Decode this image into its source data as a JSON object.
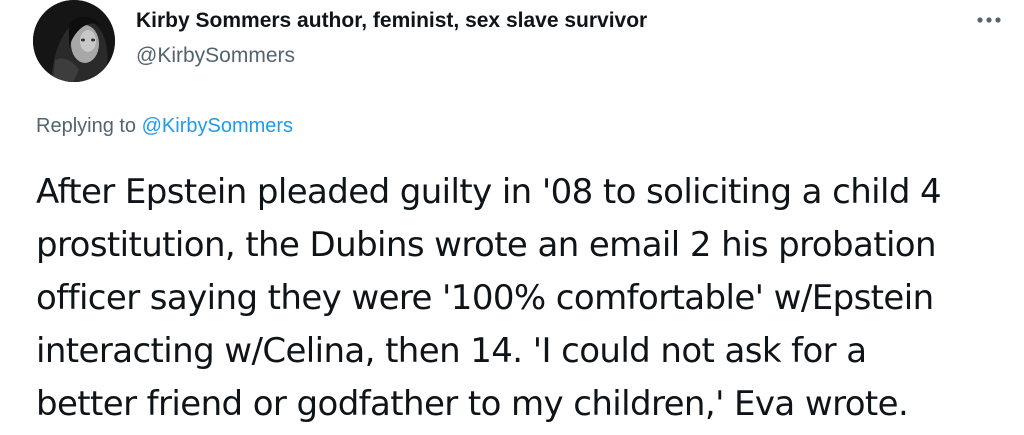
{
  "author": {
    "name": "Kirby Sommers author, feminist, sex slave survivor",
    "handle": "@KirbySommers",
    "avatar_icon": "profile-photo"
  },
  "menu": {
    "more_icon": "more-horizontal-icon"
  },
  "reply_context": {
    "prefix": "Replying to",
    "mention": "@KirbySommers"
  },
  "tweet": {
    "lines": [
      "After Epstein pleaded guilty in '08 to soliciting a child 4",
      "prostitution, the Dubins wrote an email 2 his probation",
      "officer saying they were '100% comfortable' w/Epstein",
      "interacting w/Celina, then 14. 'I could not ask for a",
      "better friend or godfather to my children,' Eva wrote."
    ]
  },
  "colors": {
    "text_primary": "#0f1419",
    "text_secondary": "#536471",
    "link": "#1d9bf0"
  }
}
